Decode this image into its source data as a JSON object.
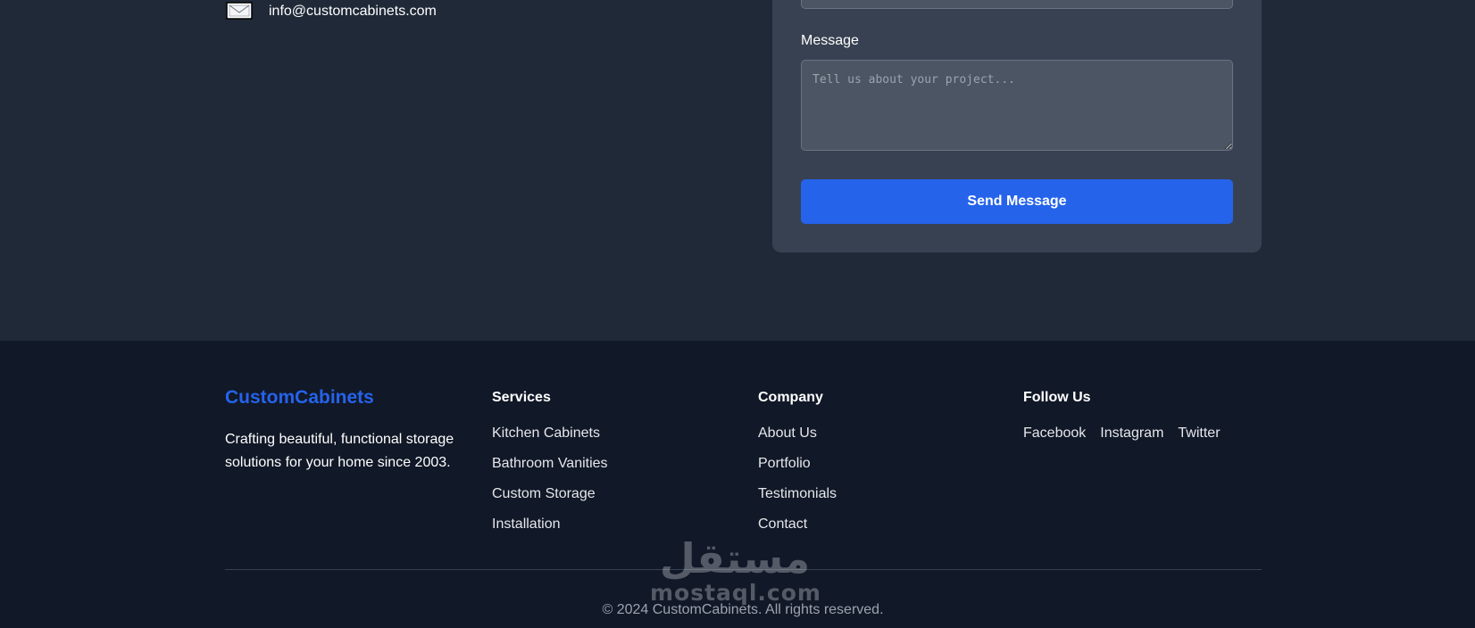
{
  "contact": {
    "email": "info@customcabinets.com",
    "icon": "envelope-icon"
  },
  "form": {
    "message_label": "Message",
    "message_placeholder": "Tell us about your project...",
    "send_label": "Send Message"
  },
  "footer": {
    "brand": "CustomCabinets",
    "tagline": "Crafting beautiful, functional storage solutions for your home since 2003.",
    "services": {
      "title": "Services",
      "links": [
        "Kitchen Cabinets",
        "Bathroom Vanities",
        "Custom Storage",
        "Installation"
      ]
    },
    "company": {
      "title": "Company",
      "links": [
        "About Us",
        "Portfolio",
        "Testimonials",
        "Contact"
      ]
    },
    "social": {
      "title": "Follow Us",
      "links": [
        "Facebook",
        "Instagram",
        "Twitter"
      ]
    },
    "copyright": "© 2024 CustomCabinets. All rights reserved."
  },
  "watermark": {
    "arabic": "مستقل",
    "latin": "mostaql.com"
  },
  "colors": {
    "accent": "#2563eb",
    "contact_bg": "#1f2937",
    "card_bg": "#374151",
    "footer_bg": "#111827"
  }
}
